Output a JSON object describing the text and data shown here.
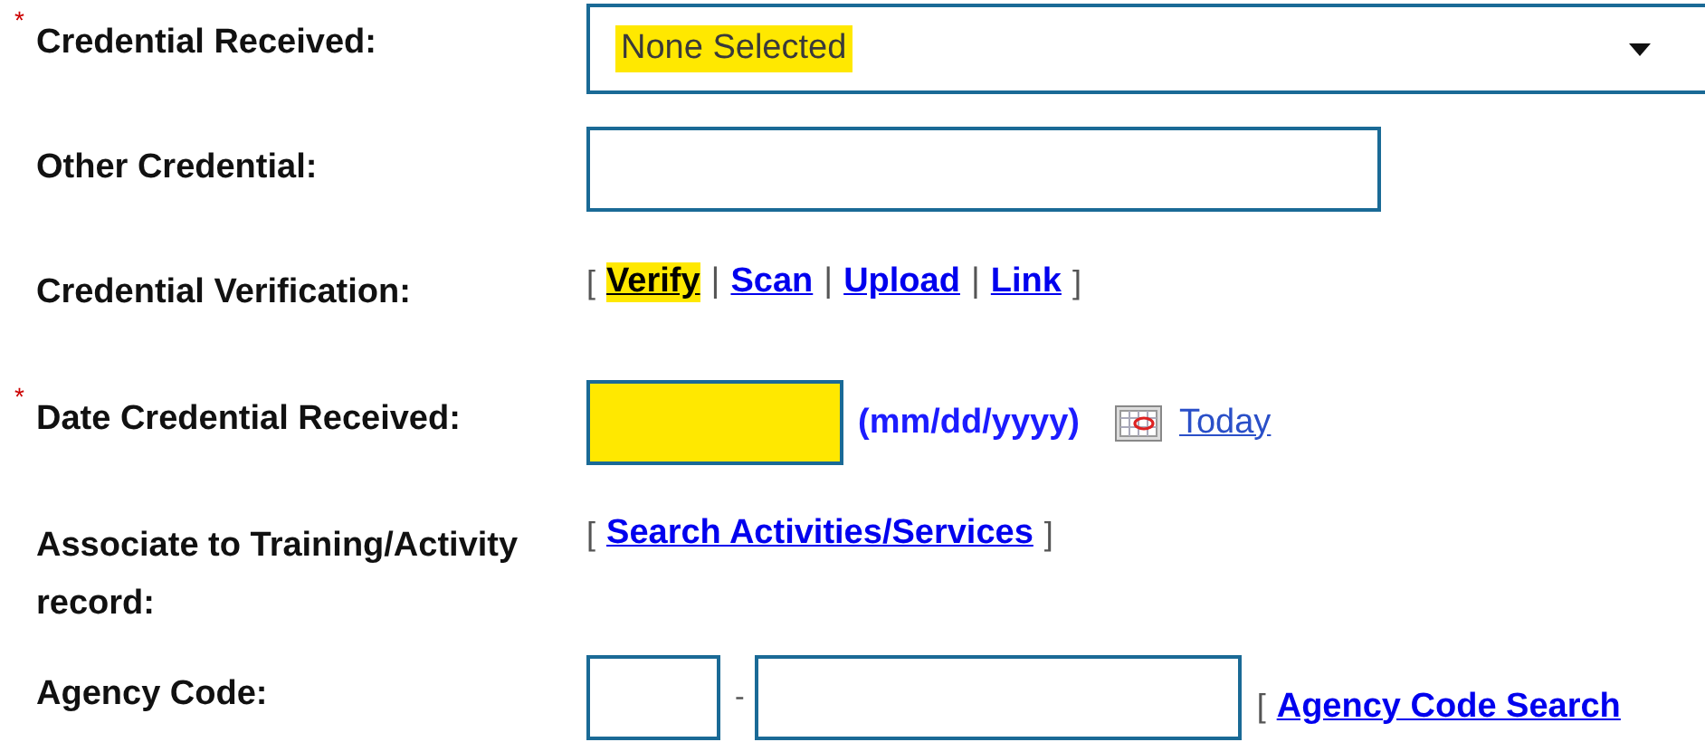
{
  "fields": [
    {
      "kind": "select",
      "label": "Credential Received:",
      "marker": "*",
      "value": "None Selected",
      "highlighted": true
    },
    {
      "kind": "text",
      "label": "Other Credential:"
    },
    {
      "kind": "links",
      "label": "Credential Verification:",
      "open": "[",
      "close": "]",
      "separator": "|",
      "links": [
        {
          "text": "Verify",
          "selected": true,
          "highlighted": true
        },
        {
          "text": "Scan",
          "selected": false,
          "highlighted": false
        },
        {
          "text": "Upload",
          "selected": false,
          "highlighted": false
        },
        {
          "text": "Link",
          "selected": false,
          "highlighted": false
        }
      ]
    },
    {
      "kind": "date",
      "label": "Date Credential Received:",
      "marker": "*",
      "highlighted": true,
      "format": "(mm/dd/yyyy)",
      "today_link": "Today"
    },
    {
      "kind": "links",
      "label": "Associate to Training/Activity record:",
      "open": "[",
      "close": "]",
      "links": [
        {
          "text": "Search Activities/Services",
          "selected": false,
          "highlighted": false
        }
      ]
    },
    {
      "kind": "agency",
      "label": "Agency Code:",
      "separator": "-",
      "open": "[",
      "search_link": "Agency Code Search"
    }
  ]
}
